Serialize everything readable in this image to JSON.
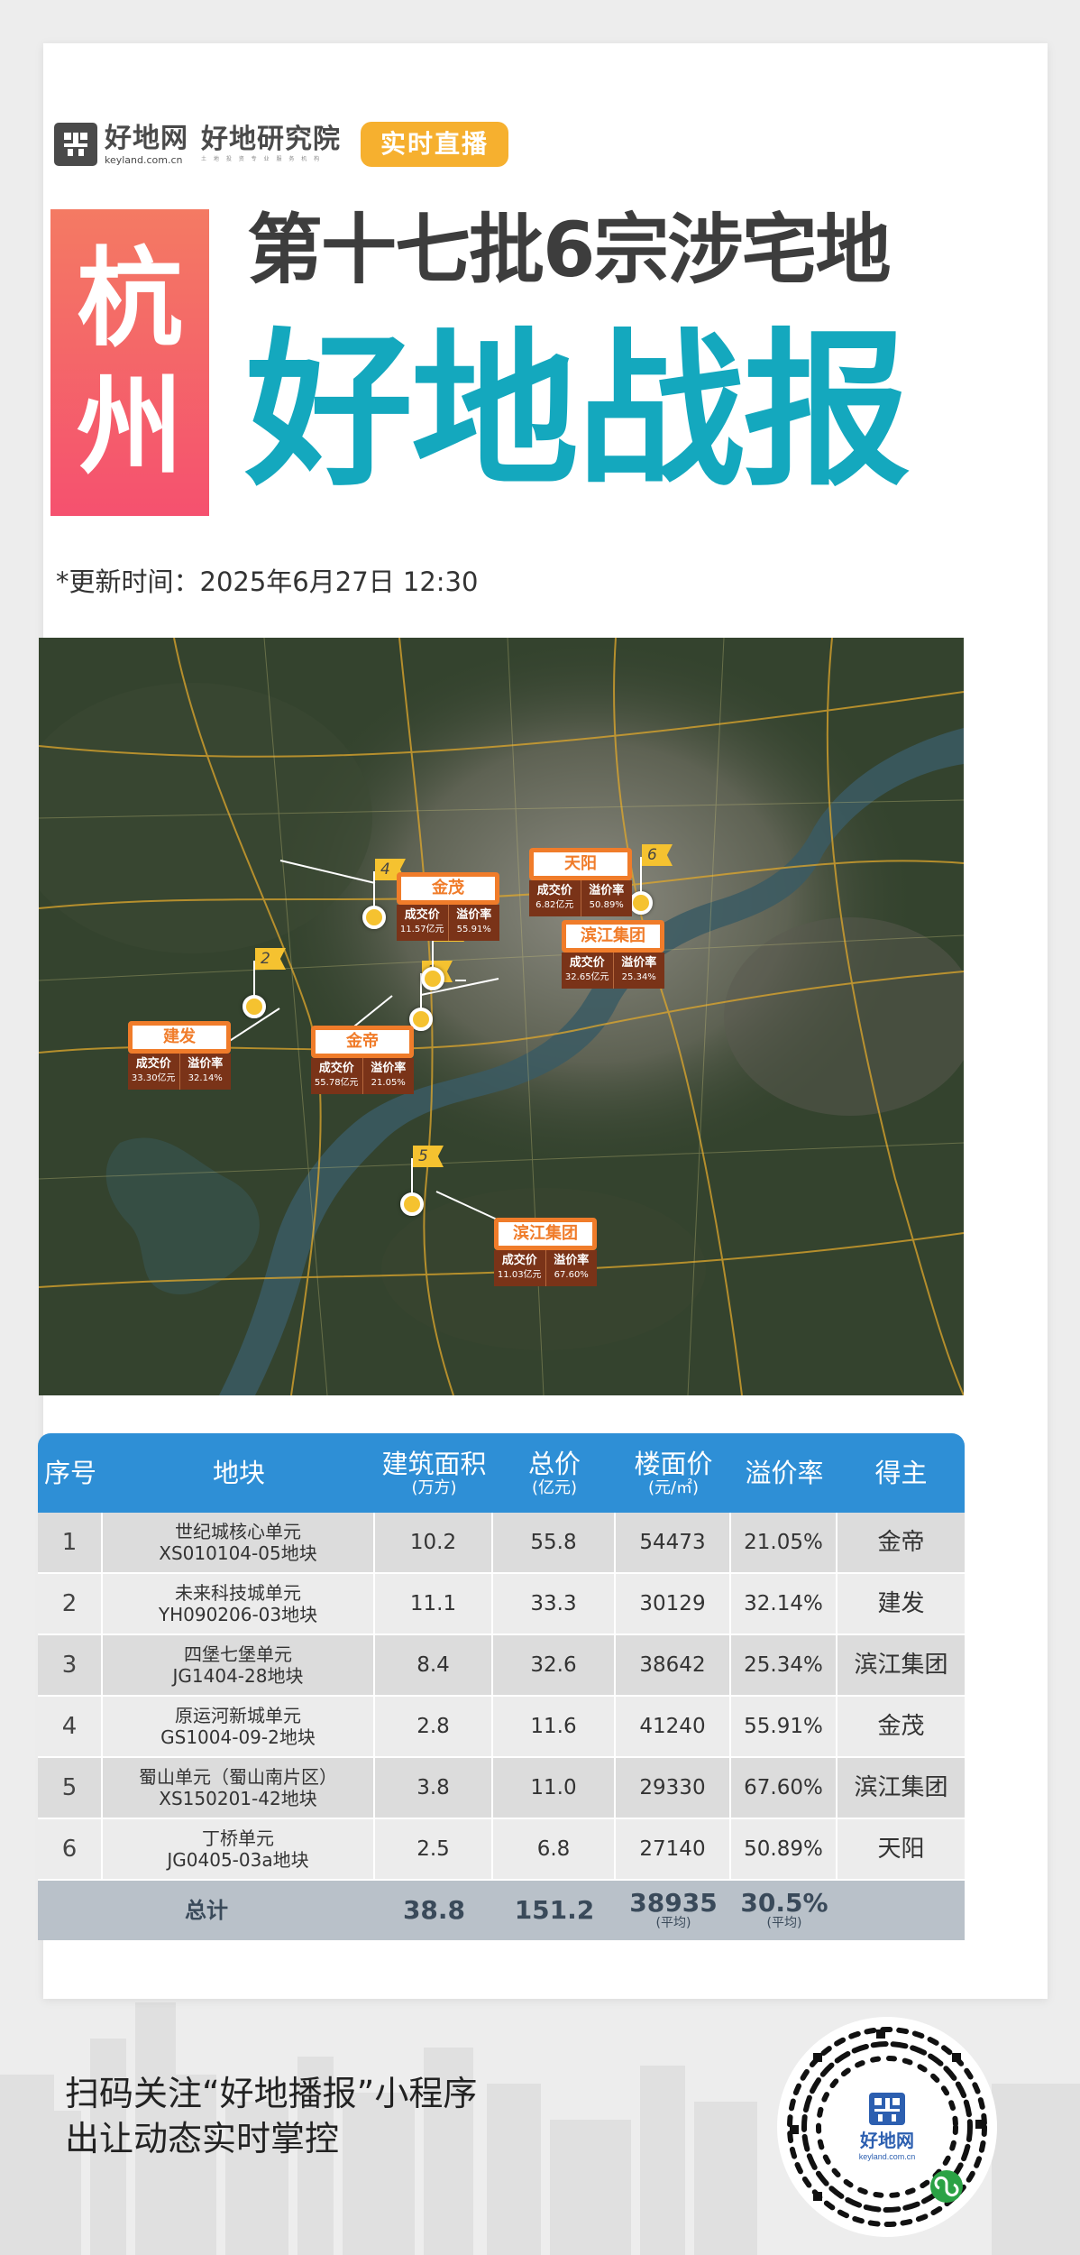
{
  "header": {
    "logo_name": "好地网",
    "logo_domain": "keyland.com.cn",
    "institute_name": "好地研究院",
    "institute_tagline": "土 地 投 资 专 业 服 务 机 构",
    "live_badge": "实时直播"
  },
  "title": {
    "city_chars": [
      "杭",
      "州"
    ],
    "line1": "第十七批6宗涉宅地",
    "line2": "好地战报"
  },
  "update_time": "*更新时间：2025年6月27日 12:30",
  "map": {
    "price_label": "成交价",
    "premium_label": "溢价率",
    "parcels": [
      {
        "num": "1",
        "name": "金帝",
        "price": "55.78亿元",
        "premium": "21.05%"
      },
      {
        "num": "2",
        "name": "建发",
        "price": "33.30亿元",
        "premium": "32.14%"
      },
      {
        "num": "3",
        "name": "滨江集团",
        "price": "32.65亿元",
        "premium": "25.34%"
      },
      {
        "num": "4",
        "name": "金茂",
        "price": "11.57亿元",
        "premium": "55.91%"
      },
      {
        "num": "5",
        "name": "滨江集团",
        "price": "11.03亿元",
        "premium": "67.60%"
      },
      {
        "num": "6",
        "name": "天阳",
        "price": "6.82亿元",
        "premium": "50.89%"
      }
    ]
  },
  "table": {
    "headers": [
      {
        "main": "序号",
        "unit": ""
      },
      {
        "main": "地块",
        "unit": ""
      },
      {
        "main": "建筑面积",
        "unit": "(万方)"
      },
      {
        "main": "总价",
        "unit": "(亿元)"
      },
      {
        "main": "楼面价",
        "unit": "(元/㎡)"
      },
      {
        "main": "溢价率",
        "unit": ""
      },
      {
        "main": "得主",
        "unit": ""
      }
    ],
    "rows": [
      {
        "no": "1",
        "plot_name": "世纪城核心单元",
        "plot_code": "XS010104-05地块",
        "area": "10.2",
        "total": "55.8",
        "floor_price": "54473",
        "premium": "21.05%",
        "winner": "金帝"
      },
      {
        "no": "2",
        "plot_name": "未来科技城单元",
        "plot_code": "YH090206-03地块",
        "area": "11.1",
        "total": "33.3",
        "floor_price": "30129",
        "premium": "32.14%",
        "winner": "建发"
      },
      {
        "no": "3",
        "plot_name": "四堡七堡单元",
        "plot_code": "JG1404-28地块",
        "area": "8.4",
        "total": "32.6",
        "floor_price": "38642",
        "premium": "25.34%",
        "winner": "滨江集团"
      },
      {
        "no": "4",
        "plot_name": "原运河新城单元",
        "plot_code": "GS1004-09-2地块",
        "area": "2.8",
        "total": "11.6",
        "floor_price": "41240",
        "premium": "55.91%",
        "winner": "金茂"
      },
      {
        "no": "5",
        "plot_name": "蜀山单元（蜀山南片区）",
        "plot_code": "XS150201-42地块",
        "area": "3.8",
        "total": "11.0",
        "floor_price": "29330",
        "premium": "67.60%",
        "winner": "滨江集团"
      },
      {
        "no": "6",
        "plot_name": "丁桥单元",
        "plot_code": "JG0405-03a地块",
        "area": "2.5",
        "total": "6.8",
        "floor_price": "27140",
        "premium": "50.89%",
        "winner": "天阳"
      }
    ],
    "total": {
      "label": "总计",
      "area": "38.8",
      "total": "151.2",
      "floor_price": "38935",
      "floor_price_note": "(平均)",
      "premium": "30.5%",
      "premium_note": "(平均)"
    }
  },
  "footer": {
    "line1": "扫码关注“好地播报”小程序",
    "line2": "出让动态实时掌控",
    "qr_brand": "好地网",
    "qr_domain": "keyland.com.cn"
  }
}
